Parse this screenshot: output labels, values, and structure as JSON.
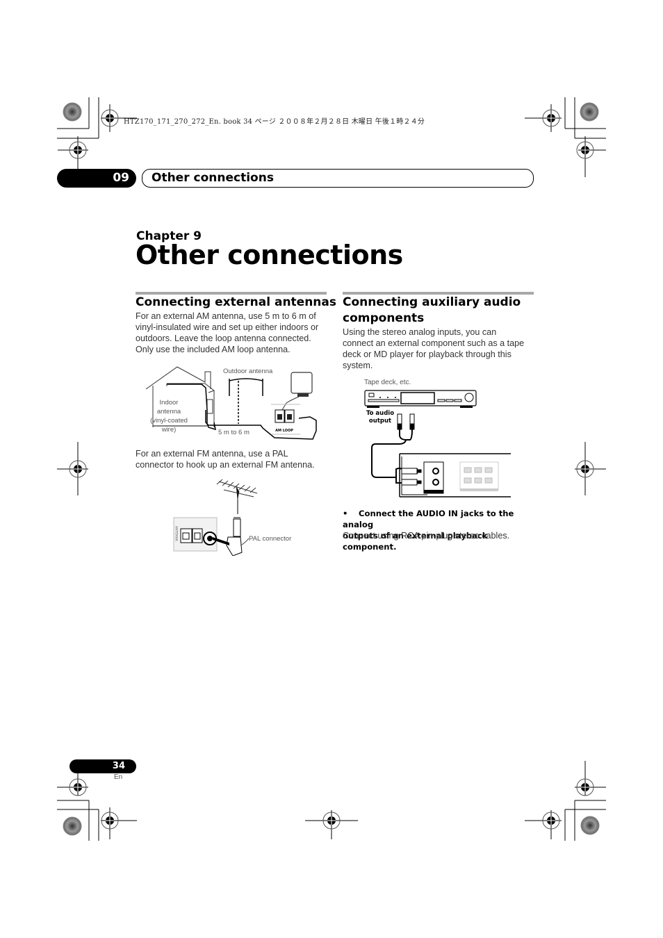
{
  "print_header": "HTZ170_171_270_272_En. book   34 ページ   ２００８年２月２８日   木曜日   午後１時２４分",
  "chapter_tab": {
    "number": "09",
    "title": "Other connections"
  },
  "chapter": {
    "label": "Chapter 9",
    "title": "Other connections"
  },
  "left_section": {
    "title": "Connecting external antennas",
    "intro_lines": [
      "For an external AM antenna, use 5 m to 6 m of",
      "vinyl-insulated wire and set up either indoors or",
      "outdoors. Leave the loop antenna connected.",
      "Only use the included AM loop antenna."
    ],
    "am_figure": {
      "outdoor_label": "Outdoor antenna",
      "indoor_label_lines": [
        "Indoor",
        "antenna",
        "(vinyl-coated",
        "wire)"
      ],
      "distance_label": "5 m to 6 m",
      "terminal_label": "AM LOOP"
    },
    "fm_text_lines": [
      "For an external FM antenna, use a PAL",
      "connector to hook up an external FM antenna."
    ],
    "fm_figure": {
      "connector_label": "PAL connector",
      "panel_label": "ANTENNA"
    }
  },
  "right_section": {
    "title_lines": [
      "Connecting auxiliary audio",
      "components"
    ],
    "intro_lines": [
      "Using the stereo analog inputs, you can",
      "connect an external component such as a tape",
      "deck or MD player for playback through this",
      "system."
    ],
    "figure": {
      "device_label": "Tape deck, etc.",
      "output_label_lines": [
        "To audio",
        "output"
      ]
    },
    "bullet": "•",
    "instruction_lines": [
      "Connect the AUDIO IN jacks to the analog",
      "outputs of an external playback component."
    ],
    "note": "Connect using RCA pin-plug stereo cables."
  },
  "footer": {
    "page_number": "34",
    "language": "En"
  }
}
